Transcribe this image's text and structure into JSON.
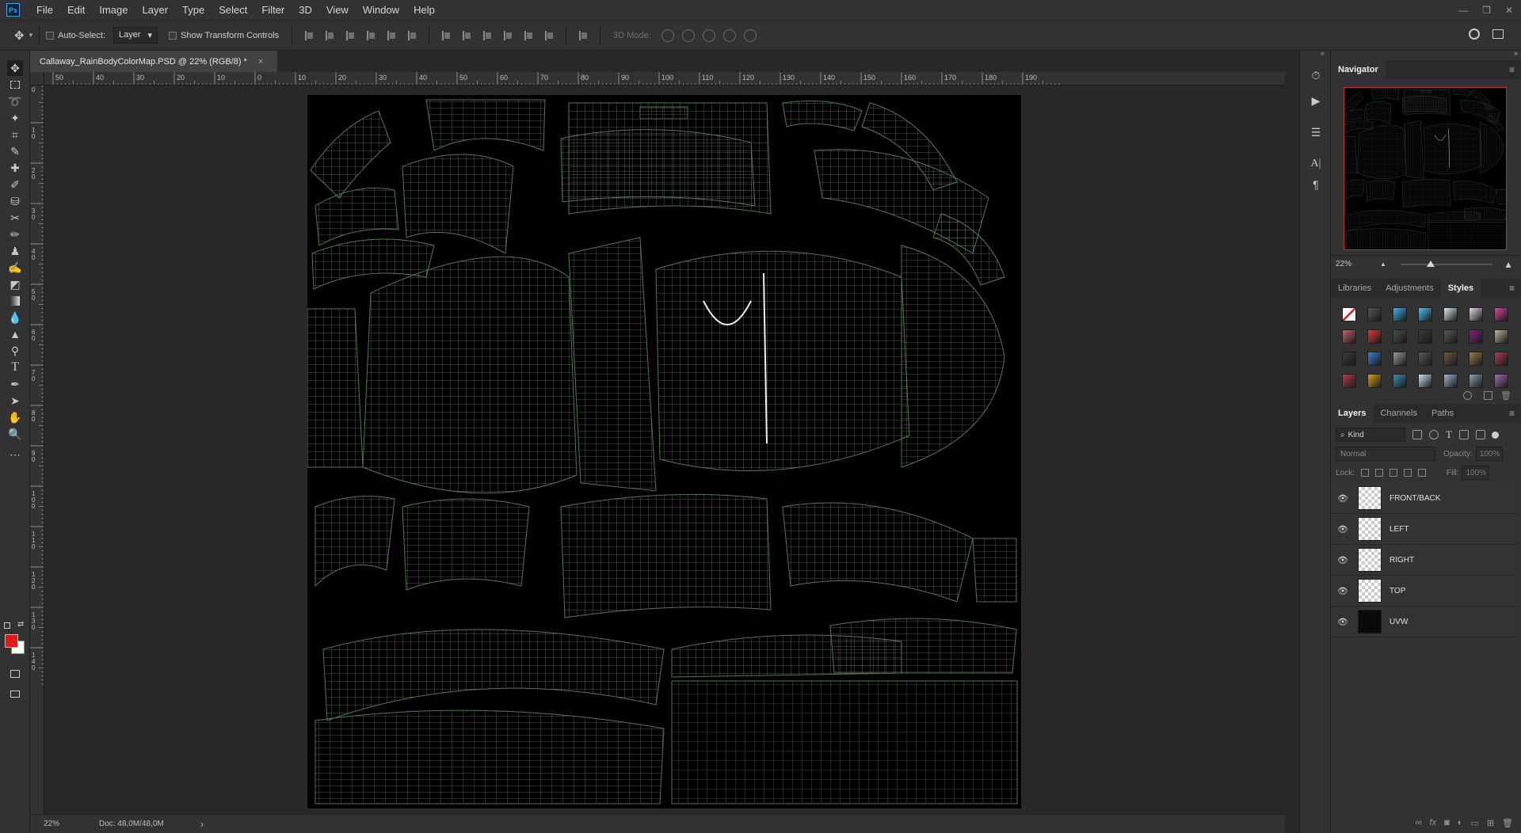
{
  "app": {
    "logo_text": "Ps"
  },
  "menu": [
    "File",
    "Edit",
    "Image",
    "Layer",
    "Type",
    "Select",
    "Filter",
    "3D",
    "View",
    "Window",
    "Help"
  ],
  "window_controls": {
    "minimize": "—",
    "restore": "❐",
    "close": "✕"
  },
  "options_bar": {
    "auto_select_label": "Auto-Select:",
    "auto_select_target": "Layer",
    "show_transform_label": "Show Transform Controls",
    "mode_3d_label": "3D Mode:"
  },
  "document": {
    "tab_title": "Callaway_RainBodyColorMap.PSD @ 22% (RGB/8) *",
    "close_label": "×",
    "zoom": "22%",
    "doc_size": "Doc: 48,0M/48,0M",
    "status_arrow": "›"
  },
  "ruler_top_labels": [
    "50",
    "40",
    "30",
    "20",
    "10",
    "0",
    "10",
    "20",
    "30",
    "40",
    "50",
    "60",
    "70",
    "80",
    "90",
    "100",
    "110",
    "120",
    "130",
    "140",
    "150",
    "160",
    "170",
    "180",
    "190"
  ],
  "ruler_left_labels": [
    "0",
    "1\n0",
    "2\n0",
    "3\n0",
    "4\n0",
    "5\n0",
    "6\n0",
    "7\n0",
    "8\n0",
    "9\n0",
    "1\n0\n0",
    "1\n1\n0",
    "1\n2\n0",
    "1\n3\n0",
    "1\n4\n0"
  ],
  "panels": {
    "navigator_title": "Navigator",
    "navigator_zoom": "22%",
    "navigator_zoom_fraction": 0.33,
    "middle_tabs": [
      "Libraries",
      "Adjustments",
      "Styles"
    ],
    "middle_active": "Styles",
    "layers_tabs": [
      "Layers",
      "Channels",
      "Paths"
    ],
    "layers_active": "Layers",
    "kind_filter": "Kind",
    "blend_mode": "Normal",
    "opacity_label": "Opacity:",
    "opacity_value": "100%",
    "lock_label": "Lock:",
    "fill_label": "Fill:",
    "fill_value": "100%"
  },
  "style_swatches": [
    "#ffffff",
    "#555555",
    "#37b7e8",
    "#42c6f2",
    "#dde8f0",
    "#e8d6e8",
    "#e040a0",
    "#c86464",
    "#e23a3a",
    "#4e4e4e",
    "#3a3a3a",
    "#585858",
    "#8c2080",
    "#b9b2a2",
    "#3c3c3c",
    "#3d7fd6",
    "#9a9a9a",
    "#5a5a5a",
    "#6e5a3c",
    "#a07c4c",
    "#b03c5a",
    "#b83c50",
    "#d8a020",
    "#3c8cb4",
    "#c8e0f4",
    "#9ab4d6",
    "#8ca0b4",
    "#a46ab4"
  ],
  "layers": [
    {
      "name": "FRONT/BACK",
      "thumb": "transparent"
    },
    {
      "name": "LEFT",
      "thumb": "transparent"
    },
    {
      "name": "RIGHT",
      "thumb": "transparent"
    },
    {
      "name": "TOP",
      "thumb": "transparent"
    },
    {
      "name": "UVW",
      "thumb": "dark"
    }
  ],
  "colors": {
    "foreground": "#e11919",
    "background": "#ffffff",
    "wire_white": "#bfbfbf",
    "wire_green": "#4f7a4f"
  }
}
